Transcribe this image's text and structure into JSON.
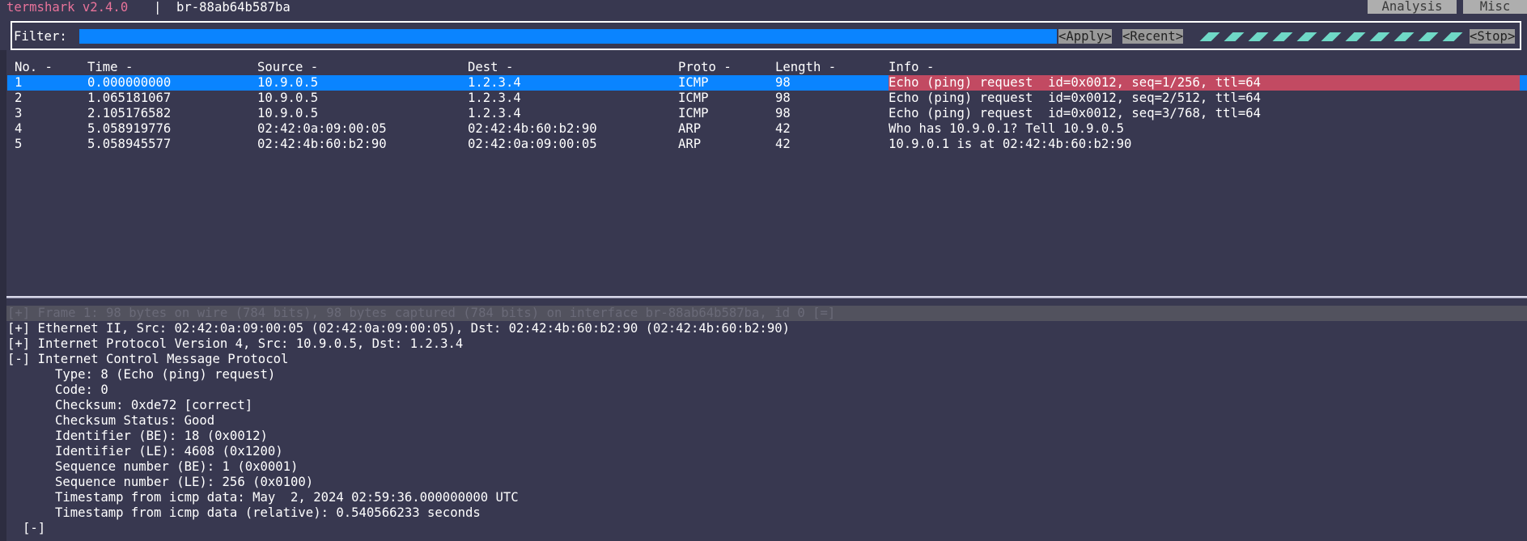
{
  "topbar": {
    "app_name": "termshark v2.4.0",
    "separator": "|",
    "interface": "br-88ab64b587ba",
    "menu": {
      "analysis": "Analysis",
      "misc": "Misc"
    }
  },
  "filter": {
    "label": "Filter:",
    "value": "",
    "apply": "<Apply>",
    "recent": "<Recent>",
    "stop": "<Stop>"
  },
  "colors": {
    "background": "#383850",
    "selected_row": "#0a84ff",
    "info_highlight": "#c24a62",
    "app_name": "#e8739a",
    "progress": "#6fd8c6"
  },
  "packet_list": {
    "headers": {
      "no": "No. -",
      "time": "Time -",
      "source": "Source -",
      "dest": "Dest -",
      "proto": "Proto -",
      "length": "Length -",
      "info": "Info -"
    },
    "rows": [
      {
        "no": "1",
        "time": "0.000000000",
        "source": "10.9.0.5",
        "dest": "1.2.3.4",
        "proto": "ICMP",
        "length": "98",
        "info": "Echo (ping) request  id=0x0012, seq=1/256, ttl=64",
        "selected": true
      },
      {
        "no": "2",
        "time": "1.065181067",
        "source": "10.9.0.5",
        "dest": "1.2.3.4",
        "proto": "ICMP",
        "length": "98",
        "info": "Echo (ping) request  id=0x0012, seq=2/512, ttl=64",
        "selected": false
      },
      {
        "no": "3",
        "time": "2.105176582",
        "source": "10.9.0.5",
        "dest": "1.2.3.4",
        "proto": "ICMP",
        "length": "98",
        "info": "Echo (ping) request  id=0x0012, seq=3/768, ttl=64",
        "selected": false
      },
      {
        "no": "4",
        "time": "5.058919776",
        "source": "02:42:0a:09:00:05",
        "dest": "02:42:4b:60:b2:90",
        "proto": "ARP",
        "length": "42",
        "info": "Who has 10.9.0.1? Tell 10.9.0.5",
        "selected": false
      },
      {
        "no": "5",
        "time": "5.058945577",
        "source": "02:42:4b:60:b2:90",
        "dest": "02:42:0a:09:00:05",
        "proto": "ARP",
        "length": "42",
        "info": "10.9.0.1 is at 02:42:4b:60:b2:90",
        "selected": false
      }
    ]
  },
  "details": {
    "frame": "[+] Frame 1: 98 bytes on wire (784 bits), 98 bytes captured (784 bits) on interface br-88ab64b587ba, id 0 [=]",
    "ethernet": "[+] Ethernet II, Src: 02:42:0a:09:00:05 (02:42:0a:09:00:05), Dst: 02:42:4b:60:b2:90 (02:42:4b:60:b2:90)",
    "ip": "[+] Internet Protocol Version 4, Src: 10.9.0.5, Dst: 1.2.3.4",
    "icmp": "[-] Internet Control Message Protocol",
    "icmp_fields": [
      "Type: 8 (Echo (ping) request)",
      "Code: 0",
      "Checksum: 0xde72 [correct]",
      "Checksum Status: Good",
      "Identifier (BE): 18 (0x0012)",
      "Identifier (LE): 4608 (0x1200)",
      "Sequence number (BE): 1 (0x0001)",
      "Sequence number (LE): 256 (0x0100)",
      "Timestamp from icmp data: May  2, 2024 02:59:36.000000000 UTC",
      "Timestamp from icmp data (relative): 0.540566233 seconds"
    ],
    "data_toggle": "[-]"
  }
}
